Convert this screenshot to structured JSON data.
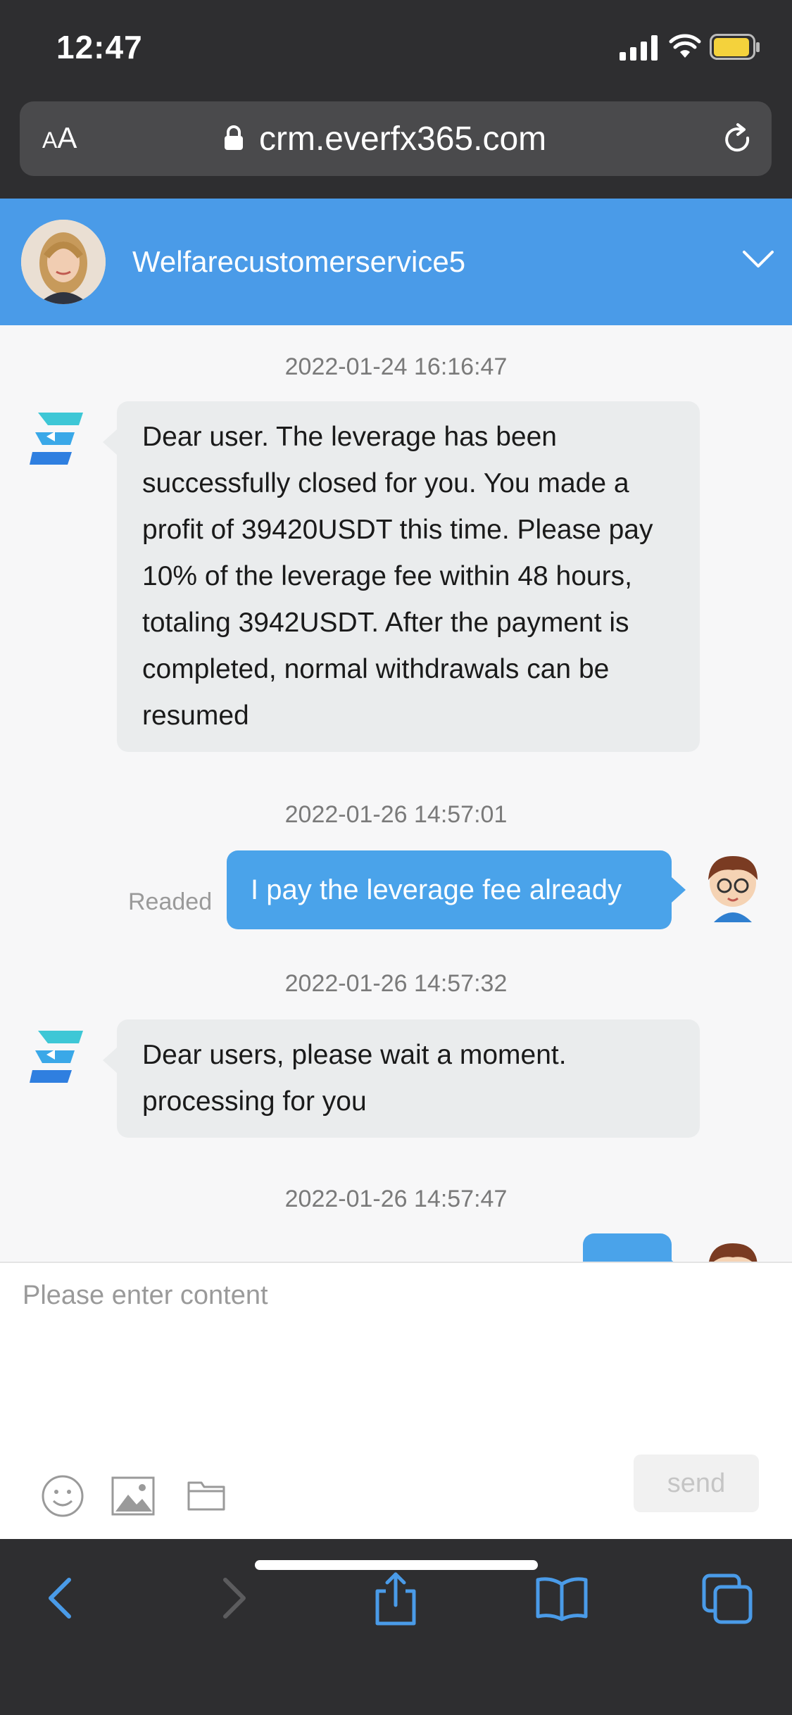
{
  "status_bar": {
    "time": "12:47"
  },
  "browser": {
    "text_size_label_small": "A",
    "text_size_label_large": "A",
    "url": "crm.everfx365.com"
  },
  "chat_header": {
    "agent_name": "Welfarecustomerservice5"
  },
  "messages": [
    {
      "timestamp": "2022-01-24 16:16:47",
      "direction": "incoming",
      "text": "Dear user. The leverage has been successfully closed for you. You made a profit of 39420USDT this time. Please pay 10% of the leverage fee within 48 hours, totaling 3942USDT. After the payment is completed, normal withdrawals can be resumed"
    },
    {
      "timestamp": "2022-01-26 14:57:01",
      "direction": "outgoing",
      "text": "I pay the leverage fee already",
      "status": "Readed"
    },
    {
      "timestamp": "2022-01-26 14:57:32",
      "direction": "incoming",
      "text": "Dear users, please wait a moment. processing for you"
    },
    {
      "timestamp": "2022-01-26 14:57:47",
      "direction": "outgoing",
      "text": ""
    }
  ],
  "composer": {
    "placeholder": "Please enter content",
    "send_label": "send",
    "tools": [
      "emoji-icon",
      "image-icon",
      "folder-icon"
    ]
  },
  "toolbar": {
    "icons": [
      "back-icon",
      "forward-icon",
      "share-icon",
      "bookmarks-icon",
      "tabs-icon"
    ]
  },
  "colors": {
    "accent": "#4a9be8",
    "bubble_out": "#4aa3ea",
    "bubble_in": "#eaeced",
    "chrome": "#2e2e30"
  }
}
